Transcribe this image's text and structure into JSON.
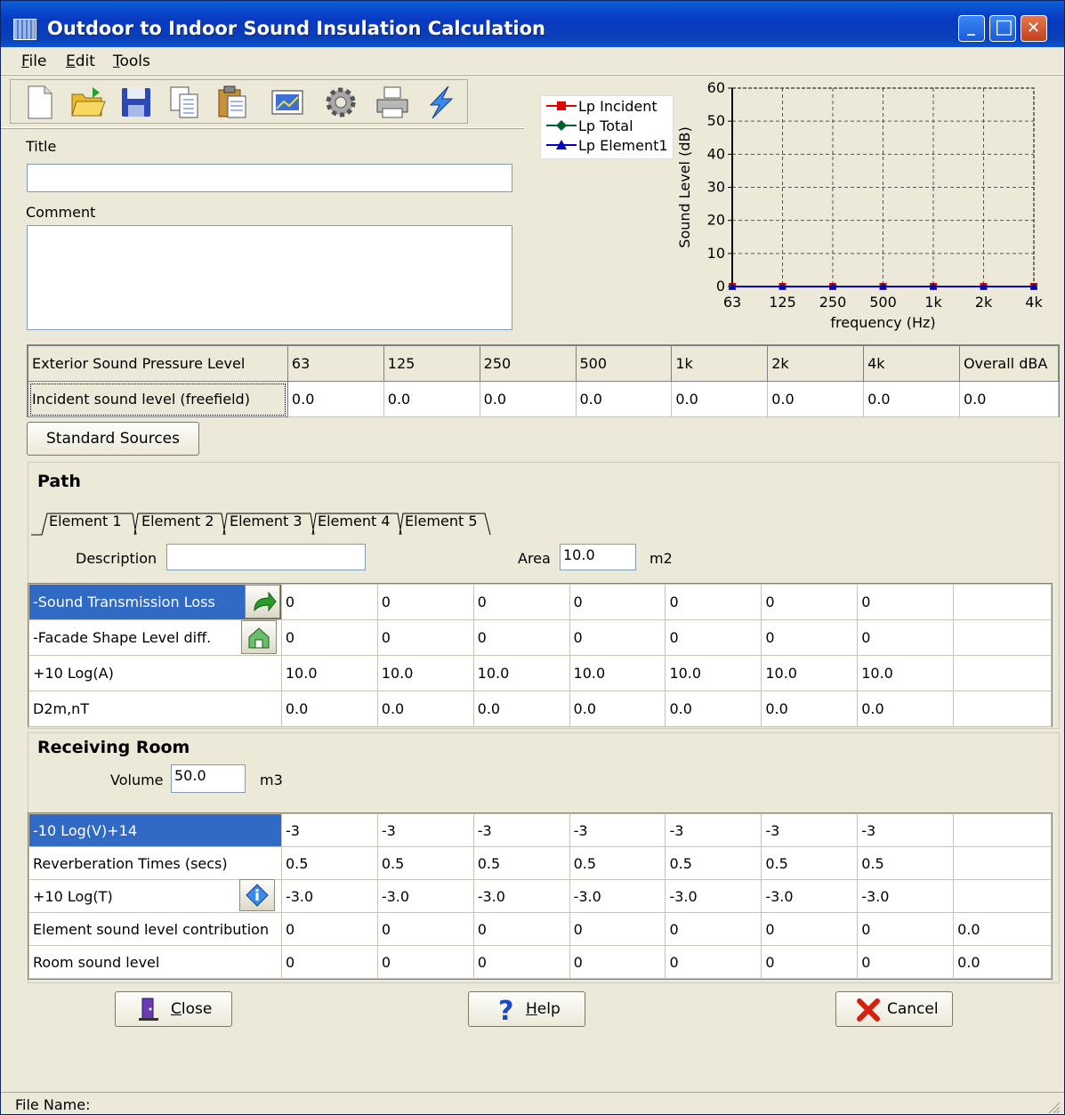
{
  "window": {
    "title": "Outdoor to Indoor Sound Insulation Calculation",
    "minimize_glyph": "_",
    "maximize_glyph": "□",
    "close_glyph": "✕"
  },
  "menu": {
    "items": [
      {
        "key": "F",
        "rest": "ile"
      },
      {
        "key": "E",
        "rest": "dit"
      },
      {
        "key": "T",
        "rest": "ools"
      }
    ]
  },
  "toolbar": {
    "icons": [
      "new-icon",
      "open-folder-icon",
      "save-icon",
      "copy-icon",
      "paste-icon",
      "chart-icon",
      "gear-icon",
      "print-icon",
      "lightning-icon"
    ]
  },
  "form": {
    "title_label": "Title",
    "title_value": "",
    "comment_label": "Comment",
    "comment_value": ""
  },
  "chart_data": {
    "type": "line",
    "categories": [
      "63",
      "125",
      "250",
      "500",
      "1k",
      "2k",
      "4k"
    ],
    "series": [
      {
        "name": "Lp Incident",
        "values": [
          0,
          0,
          0,
          0,
          0,
          0,
          0
        ],
        "color": "#e00000",
        "marker": "square"
      },
      {
        "name": "Lp Total",
        "values": [
          0,
          0,
          0,
          0,
          0,
          0,
          0
        ],
        "color": "#006030",
        "marker": "diamond"
      },
      {
        "name": "Lp Element1",
        "values": [
          0,
          0,
          0,
          0,
          0,
          0,
          0
        ],
        "color": "#0000c0",
        "marker": "triangle"
      }
    ],
    "xlabel": "frequency (Hz)",
    "ylabel": "Sound Level (dB)",
    "ylim": [
      0,
      60
    ],
    "yticks": [
      0,
      10,
      20,
      30,
      40,
      50,
      60
    ],
    "grid": true,
    "legend": "top-left"
  },
  "exterior": {
    "header": [
      "Exterior Sound Pressure Level",
      "63",
      "125",
      "250",
      "500",
      "1k",
      "2k",
      "4k",
      "Overall dBA"
    ],
    "row": [
      "Incident sound level (freefield)",
      "0.0",
      "0.0",
      "0.0",
      "0.0",
      "0.0",
      "0.0",
      "0.0",
      "0.0"
    ]
  },
  "standard_sources_label": "Standard Sources",
  "path": {
    "title": "Path",
    "tabs": [
      "Element 1",
      "Element 2",
      "Element 3",
      "Element 4",
      "Element 5"
    ],
    "description_label": "Description",
    "description_value": "",
    "area_label": "Area",
    "area_value": "10.0",
    "area_unit": "m2",
    "rows": [
      {
        "label": "-Sound Transmission Loss",
        "values": [
          "0",
          "0",
          "0",
          "0",
          "0",
          "0",
          "0",
          ""
        ]
      },
      {
        "label": "-Facade Shape Level diff.",
        "values": [
          "0",
          "0",
          "0",
          "0",
          "0",
          "0",
          "0",
          ""
        ]
      },
      {
        "label": "+10 Log(A)",
        "values": [
          "10.0",
          "10.0",
          "10.0",
          "10.0",
          "10.0",
          "10.0",
          "10.0",
          ""
        ]
      },
      {
        "label": "D2m,nT",
        "values": [
          "0.0",
          "0.0",
          "0.0",
          "0.0",
          "0.0",
          "0.0",
          "0.0",
          ""
        ]
      }
    ]
  },
  "room": {
    "title": "Receiving Room",
    "volume_label": "Volume",
    "volume_value": "50.0",
    "volume_unit": "m3",
    "rows": [
      {
        "label": "-10 Log(V)+14",
        "values": [
          "-3",
          "-3",
          "-3",
          "-3",
          "-3",
          "-3",
          "-3",
          ""
        ]
      },
      {
        "label": "Reverberation Times (secs)",
        "values": [
          "0.5",
          "0.5",
          "0.5",
          "0.5",
          "0.5",
          "0.5",
          "0.5",
          ""
        ]
      },
      {
        "label": "+10 Log(T)",
        "values": [
          "-3.0",
          "-3.0",
          "-3.0",
          "-3.0",
          "-3.0",
          "-3.0",
          "-3.0",
          ""
        ]
      },
      {
        "label": "Element sound level contribution",
        "values": [
          "0",
          "0",
          "0",
          "0",
          "0",
          "0",
          "0",
          "0.0"
        ]
      },
      {
        "label": "Room sound level",
        "values": [
          "0",
          "0",
          "0",
          "0",
          "0",
          "0",
          "0",
          "0.0"
        ]
      }
    ]
  },
  "buttons": {
    "close": {
      "key": "C",
      "rest": "lose"
    },
    "help": {
      "key": "H",
      "rest": "elp"
    },
    "cancel": "Cancel"
  },
  "status": {
    "file_name_label": "File Name:"
  }
}
